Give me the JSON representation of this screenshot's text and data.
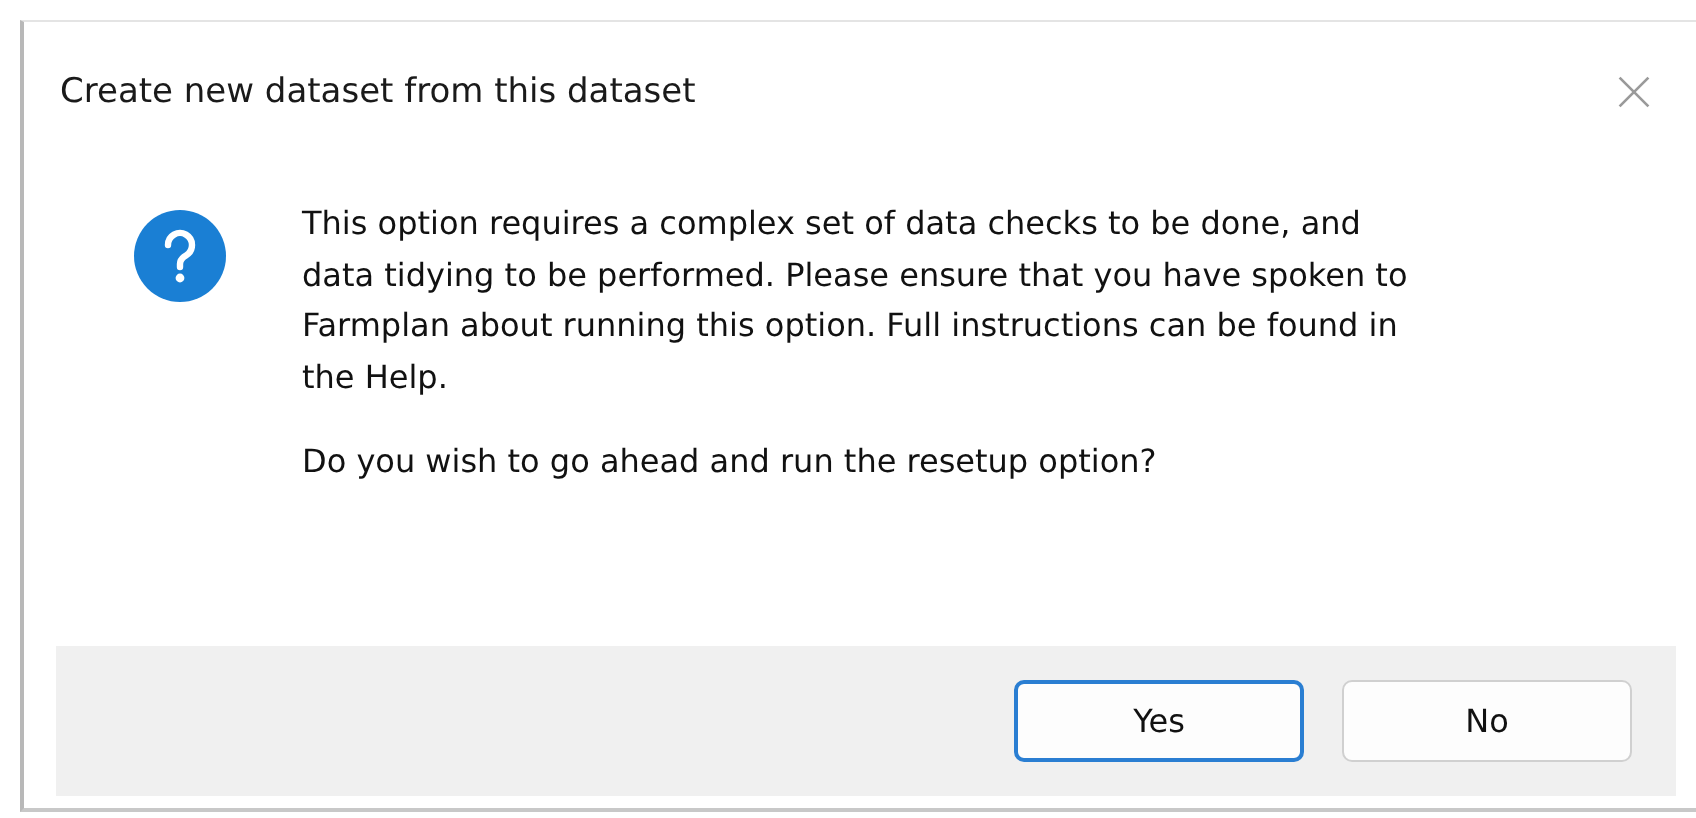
{
  "window": {
    "title": "Create new dataset from this dataset"
  },
  "message": {
    "body": "This option requires a complex set of data checks to be done, and data tidying to be performed. Please ensure that you have spoken to Farmplan about running this option. Full instructions can be found in the Help.",
    "question": "Do you wish to go ahead and run the resetup option?"
  },
  "buttons": [
    {
      "label": "Yes",
      "selected": true
    },
    {
      "label": "No",
      "selected": false
    }
  ]
}
